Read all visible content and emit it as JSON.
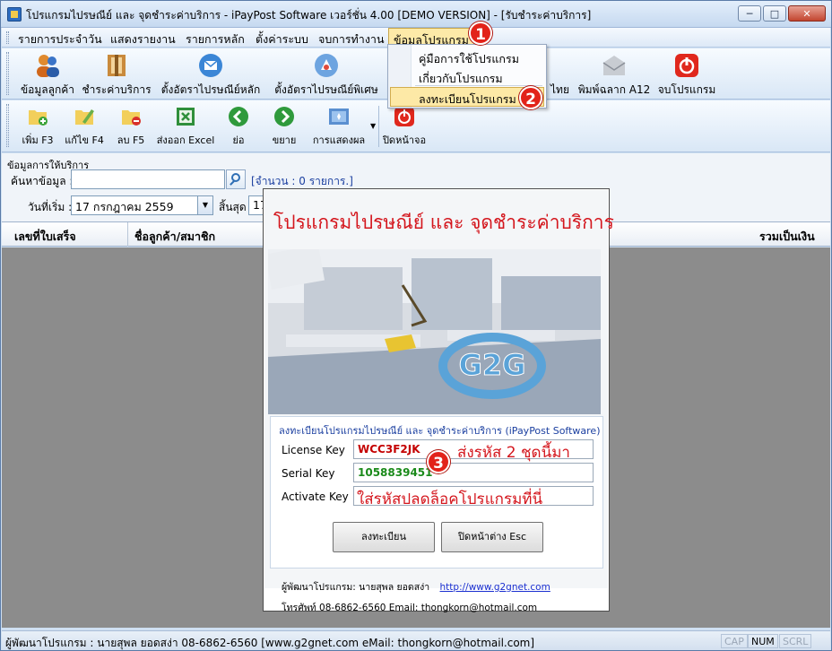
{
  "window": {
    "title": "โปรแกรมไปรษณีย์ และ จุดชำระค่าบริการ - iPayPost Software เวอร์ชั่น 4.00 [DEMO VERSION] - [รับชำระค่าบริการ]",
    "minimize": "─",
    "maximize": "□",
    "close": "✕"
  },
  "menu": {
    "items": [
      "รายการประจำวัน",
      "แสดงรายงาน",
      "รายการหลัก",
      "ตั้งค่าระบบ",
      "จบการทำงาน",
      "ข้อมูลโปรแกรม"
    ]
  },
  "dropdown": {
    "items": [
      "คู่มือการใช้โปรแกรม",
      "เกี่ยวกับโปรแกรม",
      "ลงทะเบียนโปรแกรม"
    ]
  },
  "toolbar1": {
    "items": [
      {
        "label": "ข้อมูลลูกค้า",
        "icon": "customers-icon"
      },
      {
        "label": "ชำระค่าบริการ",
        "icon": "payment-icon"
      },
      {
        "label": "ตั้งอัตราไปรษณีย์หลัก",
        "icon": "mail-rate-icon"
      },
      {
        "label": "ตั้งอัตราไปรษณีย์พิเศษ",
        "icon": "special-rate-icon"
      },
      {
        "label": "ไทย",
        "icon": "thai-post-icon"
      },
      {
        "label": "พิมพ์ฉลาก A12",
        "icon": "envelope-icon"
      },
      {
        "label": "จบโปรแกรม",
        "icon": "power-icon"
      }
    ]
  },
  "toolbar2": {
    "items": [
      {
        "label": "เพิ่ม F3",
        "icon": "add-folder-icon"
      },
      {
        "label": "แก้ไข F4",
        "icon": "edit-folder-icon"
      },
      {
        "label": "ลบ F5",
        "icon": "delete-folder-icon"
      },
      {
        "label": "ส่งออก Excel",
        "icon": "excel-icon"
      },
      {
        "label": "ย่อ",
        "icon": "collapse-arrow-icon"
      },
      {
        "label": "ขยาย",
        "icon": "expand-arrow-icon"
      },
      {
        "label": "การแสดงผล",
        "icon": "display-icon"
      },
      {
        "label": "ปิดหน้าจอ",
        "icon": "close-screen-icon"
      }
    ]
  },
  "filter": {
    "group": "ข้อมูลการให้บริการ",
    "search_label": "ค้นหาข้อมูล :",
    "search_value": "",
    "count_text": "[จำนวน : 0 รายการ.]",
    "start_label": "วันที่เริ่ม :",
    "start_value": "17  กรกฎาคม   2559",
    "end_label": "สิ้นสุด",
    "end_value": "17"
  },
  "grid": {
    "columns": [
      "เลขที่ใบเสร็จ",
      "ชื่อลูกค้า/สมาชิก",
      "รวมเป็นเงิน"
    ]
  },
  "status": {
    "text": "ผู้พัฒนาโปรแกรม : นายสุพล ยอดสง่า 08-6862-6560  [www.g2gnet.com  eMail: thongkorn@hotmail.com]",
    "cap": "CAP",
    "num": "NUM",
    "scrl": "SCRL"
  },
  "callouts": [
    "1",
    "2",
    "3"
  ],
  "dialog": {
    "title": "โปรแกรมไปรษณีย์ และ จุดชำระค่าบริการ",
    "logo": "G2G",
    "caption": "ลงทะเบียนโปรแกรมไปรษณีย์ และ จุดชำระค่าบริการ (iPayPost Software)",
    "license_label": "License Key",
    "license_value": "WCC3F2JK",
    "license_note": "ส่งรหัส 2 ชุดนี้มา",
    "serial_label": "Serial Key",
    "serial_value": "1058839451",
    "activate_label": "Activate Key",
    "activate_note": "ใส่รหัสปลดล็อคโปรแกรมที่นี่",
    "register_button": "ลงทะเบียน",
    "close_button": "ปิดหน้าต่าง Esc",
    "developer_text": "ผู้พัฒนาโปรแกรม: นายสุพล ยอดสง่า",
    "developer_link": "http://www.g2gnet.com",
    "contact_text": "โทรศัพท์ 08-6862-6560 Email: thongkorn@hotmail.com"
  },
  "colors": {
    "accent_red": "#d4161d",
    "link_blue": "#1a2fd0",
    "license_color": "#c40000",
    "serial_color": "#1a8a1a"
  }
}
